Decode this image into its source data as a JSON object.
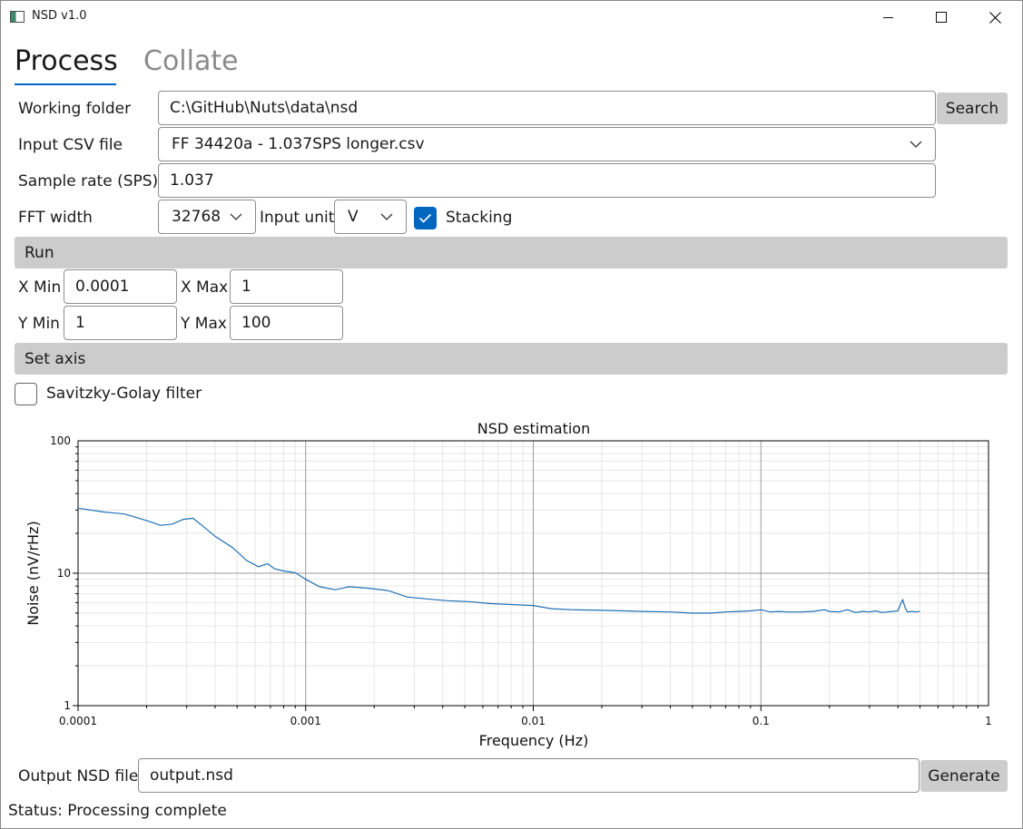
{
  "window": {
    "title": "NSD v1.0"
  },
  "tabs": [
    {
      "label": "Process"
    },
    {
      "label": "Collate"
    }
  ],
  "form": {
    "working_folder": {
      "label": "Working folder",
      "value": "C:\\GitHub\\Nuts\\data\\nsd",
      "button": "Search"
    },
    "input_csv": {
      "label": "Input CSV file",
      "value": "FF 34420a - 1.037SPS longer.csv"
    },
    "sample_rate": {
      "label": "Sample rate (SPS)",
      "value": "1.037"
    },
    "fft_width": {
      "label": "FFT width",
      "value": "32768"
    },
    "input_unit": {
      "label": "Input unit",
      "value": "V"
    },
    "stacking": {
      "label": "Stacking",
      "checked": true
    },
    "run_button": "Run",
    "xmin": {
      "label": "X Min",
      "value": "0.0001"
    },
    "xmax": {
      "label": "X Max",
      "value": "1"
    },
    "ymin": {
      "label": "Y Min",
      "value": "1"
    },
    "ymax": {
      "label": "Y Max",
      "value": "100"
    },
    "set_axis_button": "Set axis",
    "savgol": {
      "label": "Savitzky-Golay filter",
      "checked": false
    },
    "output_file": {
      "label": "Output NSD file",
      "value": "output.nsd",
      "button": "Generate"
    }
  },
  "status": "Status: Processing complete",
  "chart_data": {
    "type": "line",
    "title": "NSD estimation",
    "xlabel": "Frequency (Hz)",
    "ylabel": "Noise (nV/rHz)",
    "xscale": "log",
    "yscale": "log",
    "xlim": [
      0.0001,
      1
    ],
    "ylim": [
      1,
      100
    ],
    "xticks": [
      "0.0001",
      "0.001",
      "0.01",
      "0.1",
      "1"
    ],
    "yticks": [
      "1",
      "10",
      "100"
    ],
    "grid": true,
    "line_color": "#1f6fb4",
    "series": [
      {
        "x": [
          0.0001,
          0.00013,
          0.00016,
          0.0002,
          0.00023,
          0.00026,
          0.00029,
          0.00032,
          0.00035,
          0.0004,
          0.00048,
          0.00055,
          0.00062,
          0.00068,
          0.00073,
          0.0008,
          0.0009,
          0.001,
          0.00115,
          0.00135,
          0.00155,
          0.0019,
          0.0023,
          0.0028,
          0.0034,
          0.0042,
          0.0052,
          0.0065,
          0.008,
          0.01,
          0.012,
          0.015,
          0.02,
          0.025,
          0.03,
          0.04,
          0.05,
          0.06,
          0.07,
          0.08,
          0.09,
          0.1,
          0.11,
          0.12,
          0.13,
          0.15,
          0.17,
          0.19,
          0.2,
          0.22,
          0.24,
          0.26,
          0.28,
          0.3,
          0.32,
          0.34,
          0.36,
          0.38,
          0.4,
          0.41,
          0.42,
          0.43,
          0.44,
          0.46,
          0.48,
          0.5
        ],
        "y": [
          31,
          29,
          28,
          25,
          23,
          23.5,
          25.5,
          26,
          23,
          19,
          15.5,
          12.5,
          11.2,
          11.8,
          10.8,
          10.4,
          10.1,
          9.0,
          7.9,
          7.5,
          7.9,
          7.7,
          7.4,
          6.6,
          6.4,
          6.2,
          6.1,
          5.9,
          5.8,
          5.7,
          5.4,
          5.3,
          5.25,
          5.2,
          5.15,
          5.1,
          5.0,
          5.0,
          5.1,
          5.15,
          5.2,
          5.3,
          5.1,
          5.15,
          5.1,
          5.1,
          5.15,
          5.3,
          5.15,
          5.1,
          5.3,
          5.05,
          5.15,
          5.1,
          5.2,
          5.05,
          5.1,
          5.15,
          5.2,
          5.8,
          6.3,
          5.5,
          5.1,
          5.15,
          5.1,
          5.15
        ]
      }
    ]
  }
}
